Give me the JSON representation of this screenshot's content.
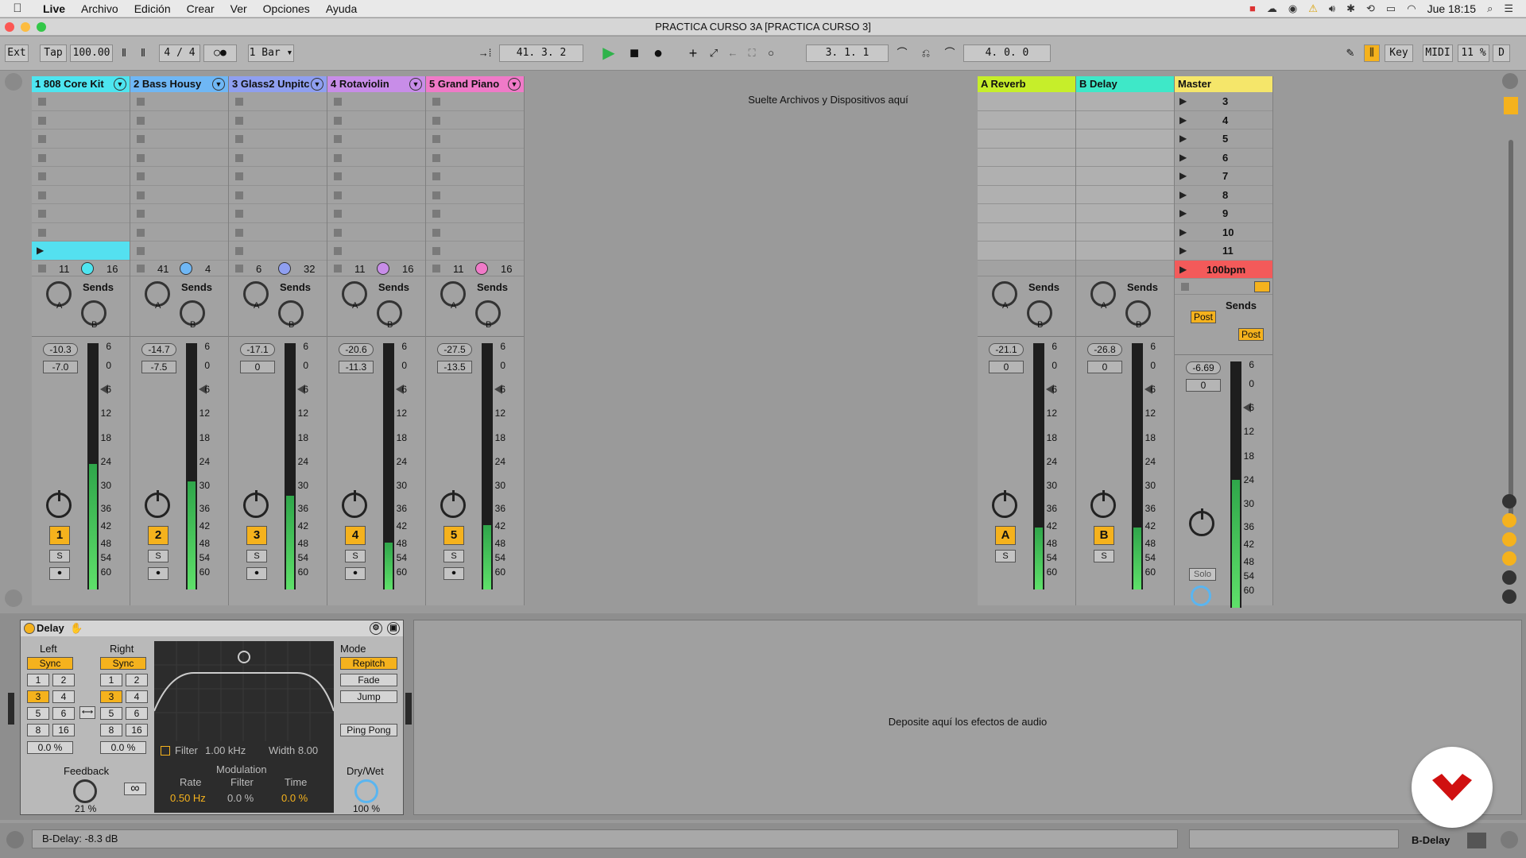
{
  "menubar": {
    "apple": "",
    "items": [
      "Live",
      "Archivo",
      "Edición",
      "Crear",
      "Ver",
      "Opciones",
      "Ayuda"
    ],
    "clock": "Jue 18:15"
  },
  "window": {
    "title": "PRACTICA CURSO 3A  [PRACTICA CURSO 3]"
  },
  "transport": {
    "ext": "Ext",
    "tap": "Tap",
    "tempo": "100.00",
    "signature_num": "4",
    "signature_sep": "/",
    "signature_den": "4",
    "quant": "1 Bar",
    "position": "41.  3.  2",
    "loop_start": "3.  1.  1",
    "loop_length": "4.  0.  0",
    "key": "Key",
    "midi": "MIDI",
    "cpu": "11 %",
    "d": "D"
  },
  "tracks": [
    {
      "name": "1 808 Core Kit",
      "color": "#4ee5f0",
      "in": "11",
      "out": "16",
      "vol": "-10.3",
      "peak": "-7.0",
      "num": "1",
      "meter": 0.51
    },
    {
      "name": "2 Bass Housy",
      "color": "#6fb7f5",
      "in": "41",
      "out": "4",
      "vol": "-14.7",
      "peak": "-7.5",
      "num": "2",
      "meter": 0.44
    },
    {
      "name": "3 Glass2 Unpitc",
      "color": "#8f9ff0",
      "in": "6",
      "out": "32",
      "vol": "-17.1",
      "peak": "0",
      "num": "3",
      "meter": 0.38
    },
    {
      "name": "4 Rotaviolin",
      "color": "#c88de8",
      "in": "11",
      "out": "16",
      "vol": "-20.6",
      "peak": "-11.3",
      "num": "4",
      "meter": 0.19
    },
    {
      "name": "5 Grand Piano",
      "color": "#f07ac8",
      "in": "11",
      "out": "16",
      "vol": "-27.5",
      "peak": "-13.5",
      "num": "5",
      "meter": 0.26
    }
  ],
  "returns": [
    {
      "name": "A Reverb",
      "color": "#c6ee2a",
      "vol": "-21.1",
      "peak": "0",
      "num": "A",
      "meter": 0.25
    },
    {
      "name": "B Delay",
      "color": "#3ee8c8",
      "vol": "-26.8",
      "peak": "0",
      "num": "B",
      "meter": 0.25
    }
  ],
  "master": {
    "name": "Master",
    "color": "#f5e66a",
    "scenes": [
      "3",
      "4",
      "5",
      "6",
      "7",
      "8",
      "9",
      "10",
      "11"
    ],
    "tempo_scene": "100bpm",
    "vol": "-6.69",
    "peak": "0",
    "solo": "Solo",
    "post1": "Post",
    "post2": "Post",
    "meter": 0.52
  },
  "sends_label": "Sends",
  "knob_a": "A",
  "knob_b": "B",
  "solo_btn": "S",
  "record_btn": "⏺",
  "scale": [
    "6",
    "0",
    "6",
    "12",
    "18",
    "24",
    "30",
    "36",
    "42",
    "48",
    "54",
    "60"
  ],
  "drop_session": "Suelte Archivos y Dispositivos aquí",
  "device": {
    "name": "Delay",
    "left": "Left",
    "right": "Right",
    "sync": "Sync",
    "nums": [
      "1",
      "2",
      "3",
      "4",
      "5",
      "6",
      "8",
      "16"
    ],
    "left_offset": "0.0 %",
    "right_offset": "0.0 %",
    "feedback_label": "Feedback",
    "feedback_val": "21 %",
    "infinity": "∞",
    "filter_label": "Filter",
    "filter_freq": "1.00 kHz",
    "width": "Width 8.00",
    "modulation": "Modulation",
    "rate_label": "Rate",
    "rate_val": "0.50 Hz",
    "filter2_label": "Filter",
    "filter2_val": "0.0 %",
    "time_label": "Time",
    "time_val": "0.0 %",
    "mode_label": "Mode",
    "repitch": "Repitch",
    "fade": "Fade",
    "jump": "Jump",
    "pingpong": "Ping Pong",
    "drywet_label": "Dry/Wet",
    "drywet_val": "100 %"
  },
  "drop_fx": "Deposite aquí los efectos de audio",
  "status": {
    "text": "B-Delay: -8.3 dB",
    "right": "B-Delay"
  }
}
